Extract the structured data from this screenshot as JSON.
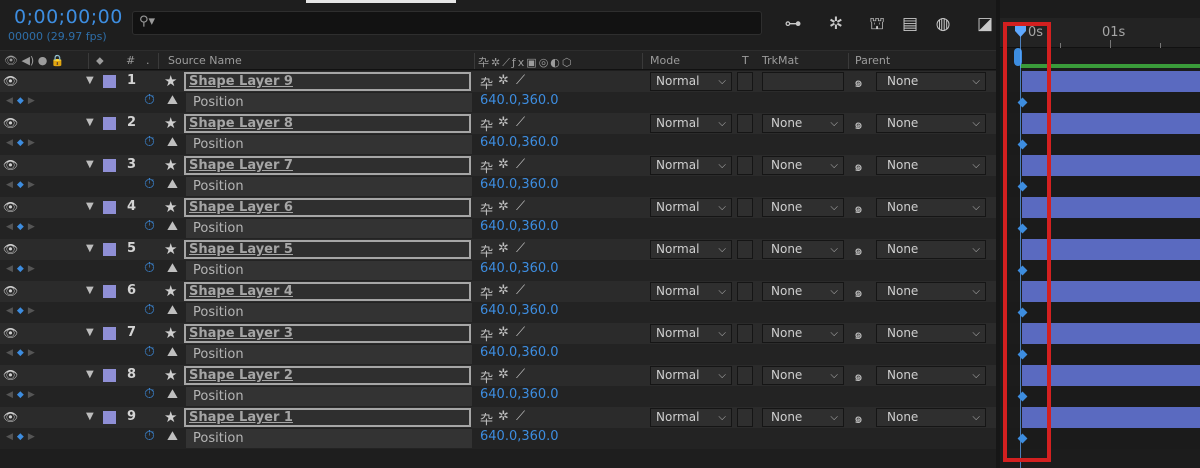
{
  "header": {
    "timecode": "0;00;00;00",
    "fps_label": "00000 (29.97 fps)",
    "search_placeholder": ""
  },
  "columns": {
    "hash": "#",
    "source_name": "Source Name",
    "mode": "Mode",
    "t": "T",
    "trkmat": "TrkMat",
    "parent": "Parent"
  },
  "timeline": {
    "ruler_labels": [
      "0s",
      "01s"
    ]
  },
  "layers": [
    {
      "num": "1",
      "name": "Shape Layer 9",
      "mode": "Normal",
      "trkmat": "",
      "parent": "None",
      "property": "Position",
      "value": "640.0,360.0"
    },
    {
      "num": "2",
      "name": "Shape Layer 8",
      "mode": "Normal",
      "trkmat": "None",
      "parent": "None",
      "property": "Position",
      "value": "640.0,360.0"
    },
    {
      "num": "3",
      "name": "Shape Layer 7",
      "mode": "Normal",
      "trkmat": "None",
      "parent": "None",
      "property": "Position",
      "value": "640.0,360.0"
    },
    {
      "num": "4",
      "name": "Shape Layer 6",
      "mode": "Normal",
      "trkmat": "None",
      "parent": "None",
      "property": "Position",
      "value": "640.0,360.0"
    },
    {
      "num": "5",
      "name": "Shape Layer 5",
      "mode": "Normal",
      "trkmat": "None",
      "parent": "None",
      "property": "Position",
      "value": "640.0,360.0"
    },
    {
      "num": "6",
      "name": "Shape Layer 4",
      "mode": "Normal",
      "trkmat": "None",
      "parent": "None",
      "property": "Position",
      "value": "640.0,360.0"
    },
    {
      "num": "7",
      "name": "Shape Layer 3",
      "mode": "Normal",
      "trkmat": "None",
      "parent": "None",
      "property": "Position",
      "value": "640.0,360.0"
    },
    {
      "num": "8",
      "name": "Shape Layer 2",
      "mode": "Normal",
      "trkmat": "None",
      "parent": "None",
      "property": "Position",
      "value": "640.0,360.0"
    },
    {
      "num": "9",
      "name": "Shape Layer 1",
      "mode": "Normal",
      "trkmat": "None",
      "parent": "None",
      "property": "Position",
      "value": "640.0,360.0"
    }
  ],
  "colors": {
    "accent": "#3d8de0",
    "label": "#8f8fd6",
    "layer_bar": "#5a6ac0",
    "highlight": "#d32020",
    "work_area": "#3a9b3a"
  }
}
